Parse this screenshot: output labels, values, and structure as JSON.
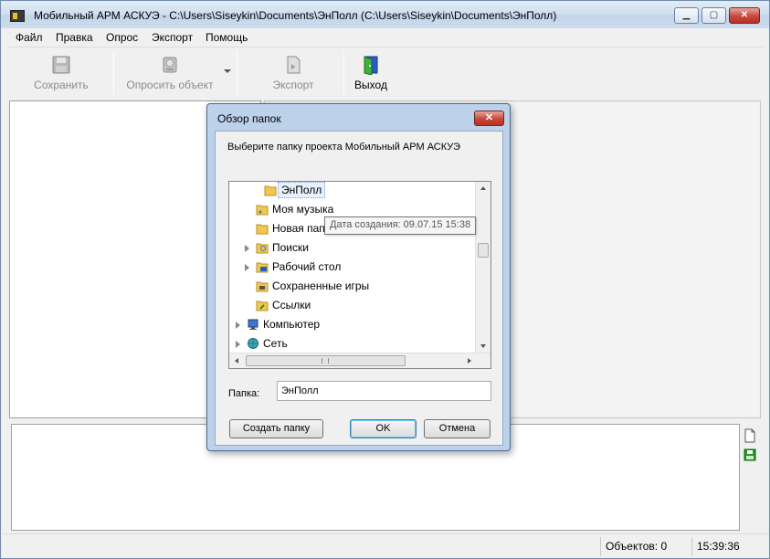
{
  "window": {
    "title": "Мобильный АРМ АСКУЭ - C:\\Users\\Siseykin\\Documents\\ЭнПолл (C:\\Users\\Siseykin\\Documents\\ЭнПолл)",
    "controls": {
      "minimize": "▁",
      "maximize": "▢",
      "close": "✕"
    }
  },
  "menu": [
    "Файл",
    "Правка",
    "Опрос",
    "Экспорт",
    "Помощь"
  ],
  "toolbar": {
    "save": {
      "label": "Сохранить",
      "enabled": false,
      "icon": "floppy-disk-icon"
    },
    "poll": {
      "label": "Опросить объект",
      "enabled": false,
      "icon": "poll-object-icon"
    },
    "export": {
      "label": "Экспорт",
      "enabled": false,
      "icon": "export-icon"
    },
    "exit": {
      "label": "Выход",
      "enabled": true,
      "icon": "exit-door-icon"
    }
  },
  "dialog": {
    "title": "Обзор папок",
    "close": "✕",
    "instruction": "Выберите папку проекта Мобильный АРМ АСКУЭ",
    "tree": [
      {
        "label": "ЭнПолл",
        "selected": true,
        "icon": "folder-icon"
      },
      {
        "label": "Моя музыка",
        "icon": "music-folder-icon"
      },
      {
        "label": "Новая папка",
        "icon": "folder-icon"
      },
      {
        "label": "Поиски",
        "icon": "search-folder-icon",
        "expandable": true
      },
      {
        "label": "Рабочий стол",
        "icon": "desktop-folder-icon",
        "expandable": true
      },
      {
        "label": "Сохраненные игры",
        "icon": "saved-games-folder-icon"
      },
      {
        "label": "Ссылки",
        "icon": "links-folder-icon"
      },
      {
        "label": "Компьютер",
        "icon": "computer-icon",
        "expandable": true
      },
      {
        "label": "Сеть",
        "icon": "network-icon",
        "expandable": true
      }
    ],
    "tooltip": "Дата создания: 09.07.15 15:38",
    "folder_label": "Папка:",
    "folder_value": "ЭнПолл",
    "buttons": {
      "create": "Создать папку",
      "ok": "OK",
      "cancel": "Отмена"
    }
  },
  "status": {
    "objects": "Объектов: 0",
    "time": "15:39:36"
  },
  "colors": {
    "accent": "#3c7fb1",
    "title_gradient": "#cfdeee",
    "close_red": "#c8483a",
    "dialog_frame": "#bcd2ea"
  }
}
